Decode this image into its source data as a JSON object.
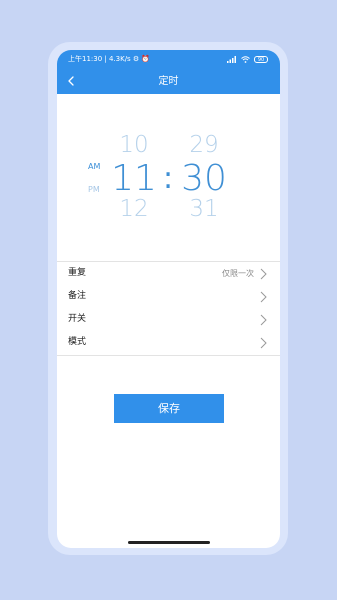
{
  "status_bar": {
    "left_text": "上午11:30 | 4.3K/s ⚙ ⏰",
    "signal_text": "📶",
    "battery_text": "90"
  },
  "header": {
    "title": "定时",
    "back_icon": "chevron-left-icon"
  },
  "picker": {
    "am_label": "AM",
    "pm_label": "PM",
    "selected_meridiem": "AM",
    "hours": [
      "10",
      "11",
      "12"
    ],
    "minutes": [
      "29",
      "30",
      "31"
    ],
    "separator": ":"
  },
  "settings": {
    "repeat": {
      "label": "重复",
      "value": "仅限一次"
    },
    "note": {
      "label": "备注"
    },
    "switch": {
      "label": "开关"
    },
    "mode": {
      "label": "模式"
    }
  },
  "save_button": {
    "label": "保存"
  },
  "colors": {
    "accent": "#3190ea",
    "background": "#c7d5f4",
    "picker_selected": "#3f8fd4",
    "picker_dim": "#b5d1ea"
  }
}
